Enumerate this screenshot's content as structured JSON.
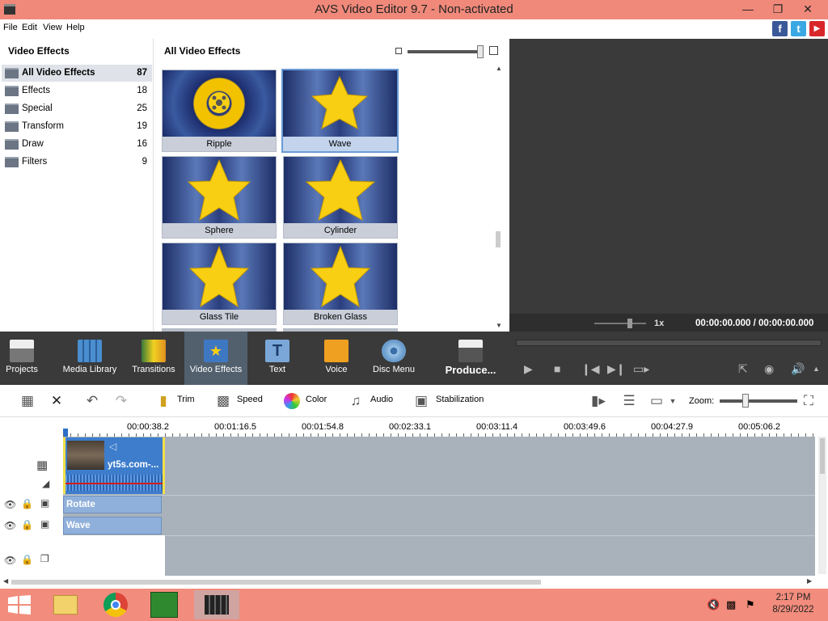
{
  "window": {
    "title": "AVS Video Editor 9.7 - Non-activated"
  },
  "menu": [
    "File",
    "Edit",
    "View",
    "Help"
  ],
  "left_panel": {
    "title": "Video Effects",
    "categories": [
      {
        "label": "All Video Effects",
        "count": "87"
      },
      {
        "label": "Effects",
        "count": "18"
      },
      {
        "label": "Special",
        "count": "25"
      },
      {
        "label": "Transform",
        "count": "19"
      },
      {
        "label": "Draw",
        "count": "16"
      },
      {
        "label": "Filters",
        "count": "9"
      }
    ]
  },
  "grid_panel": {
    "title": "All Video Effects",
    "effects": [
      "Ripple",
      "Wave",
      "Sphere",
      "Cylinder",
      "Glass Tile",
      "Broken Glass"
    ]
  },
  "preview": {
    "speed": "1x",
    "time": "00:00:00.000 / 00:00:00.000"
  },
  "toolbar": [
    "Projects",
    "Media Library",
    "Transitions",
    "Video Effects",
    "Text",
    "Voice",
    "Disc Menu",
    "Produce..."
  ],
  "edit_toolbar": {
    "trim": "Trim",
    "speed": "Speed",
    "color": "Color",
    "audio": "Audio",
    "stabilization": "Stabilization",
    "zoom_label": "Zoom:"
  },
  "ruler": [
    "00:00:38.2",
    "00:01:16.5",
    "00:01:54.8",
    "00:02:33.1",
    "00:03:11.4",
    "00:03:49.6",
    "00:04:27.9",
    "00:05:06.2"
  ],
  "timeline": {
    "clip_name": "yt5s.com-...",
    "effects": [
      "Rotate",
      "Wave"
    ]
  },
  "taskbar": {
    "time": "2:17 PM",
    "date": "8/29/2022"
  },
  "colors": {
    "titlebar": "#f0897a",
    "toolbar": "#3a3a3a",
    "accent": "#3d7dcc",
    "star": "#f8cf12"
  }
}
